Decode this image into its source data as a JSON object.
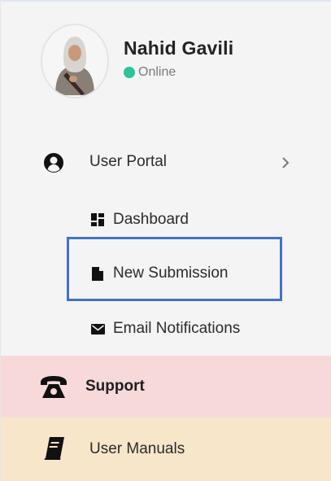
{
  "user": {
    "name": "Nahid Gavili",
    "status": "Online",
    "status_color": "#2bc39a"
  },
  "menu": {
    "user_portal": {
      "label": "User Portal",
      "icon": "user-circle-icon",
      "expandable_icon": "chevron-right-icon"
    },
    "submenu": [
      {
        "label": "Dashboard",
        "icon": "dashboard-icon"
      },
      {
        "label": "New Submission",
        "icon": "file-icon",
        "highlighted": true
      },
      {
        "label": "Email Notifications",
        "icon": "envelope-icon"
      }
    ],
    "support": {
      "label": "Support",
      "icon": "phone-icon",
      "background": "#f7d9d9"
    },
    "user_manuals": {
      "label": "User Manuals",
      "icon": "book-icon",
      "background": "#f7e6c9"
    }
  },
  "colors": {
    "highlight_border": "#4472c4",
    "sidebar_bg": "#f4f4f4"
  }
}
